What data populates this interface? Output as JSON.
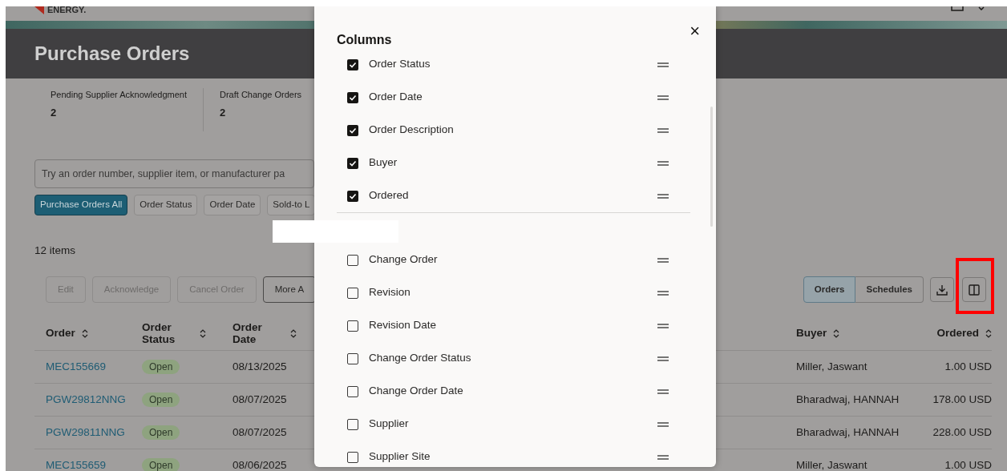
{
  "header": {
    "brand": "ENERGY."
  },
  "page_title": "Purchase Orders",
  "metrics": [
    {
      "label": "Pending Supplier Acknowledgment",
      "value": "2"
    },
    {
      "label": "Draft Change Orders",
      "value": "2"
    }
  ],
  "search": {
    "placeholder": "Try an order number, supplier item, or manufacturer pa"
  },
  "filters": [
    {
      "label": "Purchase Orders All",
      "selected": true
    },
    {
      "label": "Order Status",
      "selected": false
    },
    {
      "label": "Order Date",
      "selected": false
    },
    {
      "label": "Sold-to L",
      "selected": false
    }
  ],
  "item_count": "12 items",
  "actions": [
    {
      "label": "Edit",
      "disabled": true
    },
    {
      "label": "Acknowledge",
      "disabled": true
    },
    {
      "label": "Cancel Order",
      "disabled": true
    },
    {
      "label": "More A",
      "disabled": false
    }
  ],
  "view_toggle": [
    {
      "label": "Orders",
      "selected": true
    },
    {
      "label": "Schedules",
      "selected": false
    }
  ],
  "table": {
    "columns": [
      "Order",
      "Order Status",
      "Order Date",
      "Buyer",
      "Ordered"
    ],
    "rows": [
      {
        "order": "MEC155669",
        "status": "Open",
        "date": "08/13/2025",
        "buyer": "Miller, Jaswant",
        "ordered": "1.00 USD"
      },
      {
        "order": "PGW29812NNG",
        "status": "Open",
        "date": "08/07/2025",
        "buyer": "Bharadwaj, HANNAH",
        "ordered": "178.00 USD"
      },
      {
        "order": "PGW29811NNG",
        "status": "Open",
        "date": "08/07/2025",
        "buyer": "Bharadwaj, HANNAH",
        "ordered": "228.00 USD"
      },
      {
        "order": "MEC155659",
        "status": "Open",
        "date": "08/06/2025",
        "buyer": "Miller, Jaswant",
        "ordered": "1.00 USD"
      }
    ]
  },
  "dialog": {
    "title": "Columns",
    "close": "×",
    "items": [
      {
        "label": "Order Status",
        "checked": true
      },
      {
        "label": "Order Date",
        "checked": true
      },
      {
        "label": "Order Description",
        "checked": true
      },
      {
        "label": "Buyer",
        "checked": true
      },
      {
        "label": "Ordered",
        "checked": true
      },
      {
        "kind": "divider"
      },
      {
        "label": "Change Order",
        "checked": false
      },
      {
        "label": "Revision",
        "checked": false
      },
      {
        "label": "Revision Date",
        "checked": false
      },
      {
        "label": "Change Order Status",
        "checked": false
      },
      {
        "label": "Change Order Date",
        "checked": false
      },
      {
        "label": "Supplier",
        "checked": false
      },
      {
        "label": "Supplier Site",
        "checked": false
      }
    ]
  }
}
